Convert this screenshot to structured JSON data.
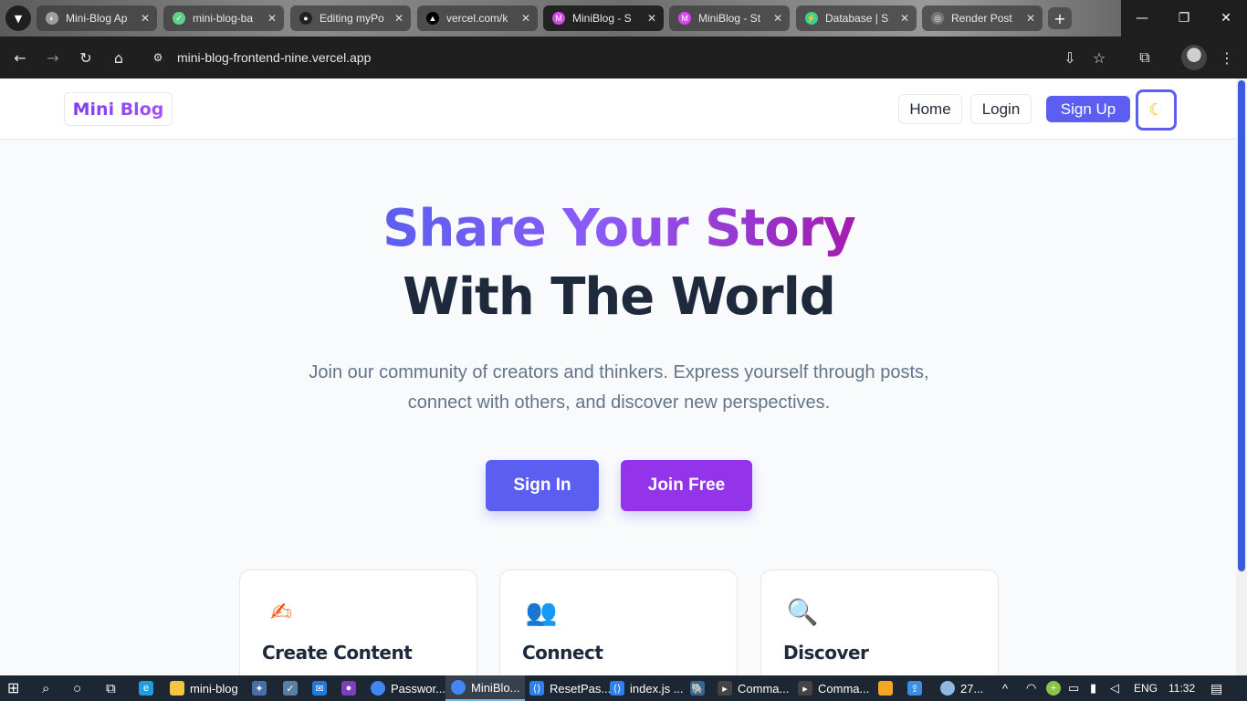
{
  "browser": {
    "tabs": [
      {
        "label": "Mini-Blog Ap",
        "icon": "compass-icon",
        "color": "#9e9e9e"
      },
      {
        "label": "mini-blog-ba",
        "icon": "render-icon",
        "color": "#5fd08a"
      },
      {
        "label": "Editing myPo",
        "icon": "github-icon",
        "color": "#222222"
      },
      {
        "label": "vercel.com/k",
        "icon": "vercel-icon",
        "color": "#000000"
      },
      {
        "label": "MiniBlog - S",
        "icon": "miniblog-icon",
        "color": "#d946ef"
      },
      {
        "label": "MiniBlog - St",
        "icon": "miniblog-icon",
        "color": "#d946ef"
      },
      {
        "label": "Database | S",
        "icon": "supabase-icon",
        "color": "#3ecf8e"
      },
      {
        "label": "Render Post",
        "icon": "globe-icon",
        "color": "#777777"
      }
    ],
    "new_tab": "+",
    "url": "mini-blog-frontend-nine.vercel.app"
  },
  "site": {
    "logo": "Mini Blog",
    "nav": {
      "home": "Home",
      "login": "Login",
      "signup": "Sign Up",
      "theme_icon": "☾"
    },
    "hero": {
      "line1_a": "Share Your Story",
      "line2": "With The World",
      "subtitle": "Join our community of creators and thinkers. Express yourself through posts, connect with others, and discover new perspectives."
    },
    "cta": {
      "signin": "Sign In",
      "join": "Join Free"
    },
    "features": [
      {
        "title": "Create Content",
        "icon": "✍"
      },
      {
        "title": "Connect",
        "icon": "👥"
      },
      {
        "title": "Discover",
        "icon": "🔍"
      }
    ]
  },
  "taskbar": {
    "items": [
      {
        "label": "mini-blog",
        "icon": "folder-icon",
        "color": "#f5c542"
      },
      {
        "label": "Passwor...",
        "icon": "chrome-icon",
        "color": "#4285f4"
      },
      {
        "label": "MiniBlo...",
        "icon": "chrome-icon",
        "color": "#4285f4"
      },
      {
        "label": "ResetPas...",
        "icon": "vscode-icon",
        "color": "#2f80ed"
      },
      {
        "label": "index.js ...",
        "icon": "vscode-icon",
        "color": "#2f80ed"
      },
      {
        "label": "Comma...",
        "icon": "terminal-icon",
        "color": "#444444"
      },
      {
        "label": "Comma...",
        "icon": "terminal-icon",
        "color": "#444444"
      }
    ],
    "weather": "27...",
    "language": "ENG",
    "time": "11:32"
  }
}
